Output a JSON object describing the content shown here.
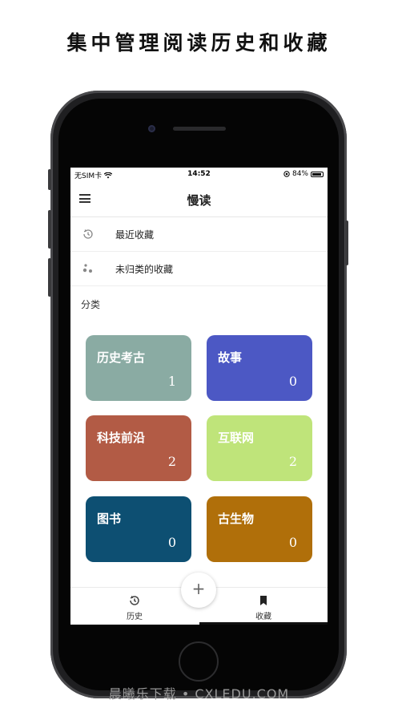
{
  "headline": "集中管理阅读历史和收藏",
  "status_bar": {
    "carrier": "无SIM卡",
    "time": "14:52",
    "battery": "84%"
  },
  "navbar": {
    "title": "慢读"
  },
  "list": {
    "recent": "最近收藏",
    "uncategorized": "未归类的收藏"
  },
  "section_label": "分类",
  "categories": [
    {
      "name": "历史考古",
      "count": "1",
      "color": "#8aaba3"
    },
    {
      "name": "故事",
      "count": "0",
      "color": "#4c58c4"
    },
    {
      "name": "科技前沿",
      "count": "2",
      "color": "#b25b45"
    },
    {
      "name": "互联网",
      "count": "2",
      "color": "#bfe47a"
    },
    {
      "name": "图书",
      "count": "0",
      "color": "#0d4f72"
    },
    {
      "name": "古生物",
      "count": "0",
      "color": "#b06f0a"
    }
  ],
  "fab": {
    "label": "+"
  },
  "tabs": [
    {
      "label": "历史",
      "icon": "history-icon"
    },
    {
      "label": "收藏",
      "icon": "bookmark-icon"
    }
  ],
  "watermark": "晨曦乐下载 • CXLEDU.COM"
}
